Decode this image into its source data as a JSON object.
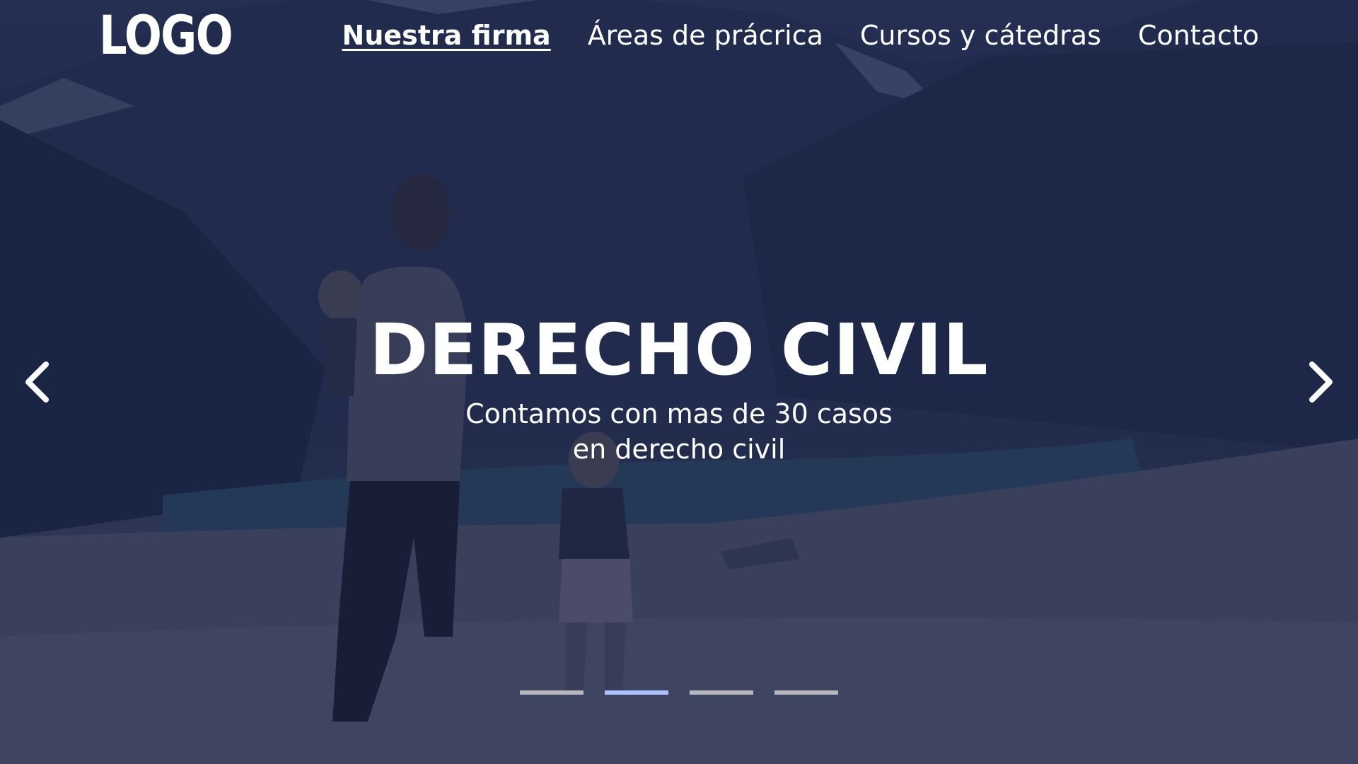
{
  "brand": {
    "logo_text": "LOGO"
  },
  "nav": {
    "items": [
      {
        "label": "Nuestra firma",
        "active": true
      },
      {
        "label": "Áreas de prácrica",
        "active": false
      },
      {
        "label": "Cursos y cátedras",
        "active": false
      },
      {
        "label": "Contacto",
        "active": false
      }
    ]
  },
  "slide": {
    "title": "DERECHO CIVIL",
    "text": "Contamos con mas de 30 casos en derecho civil"
  },
  "carousel": {
    "prev_icon": "chevron-left-icon",
    "next_icon": "chevron-right-icon",
    "indicator_count": 4,
    "active_index": 1
  },
  "colors": {
    "overlay": "#18214a",
    "text": "#ffffff",
    "indicator": "#b9b9bd",
    "indicator_active": "#a9c4ff"
  }
}
